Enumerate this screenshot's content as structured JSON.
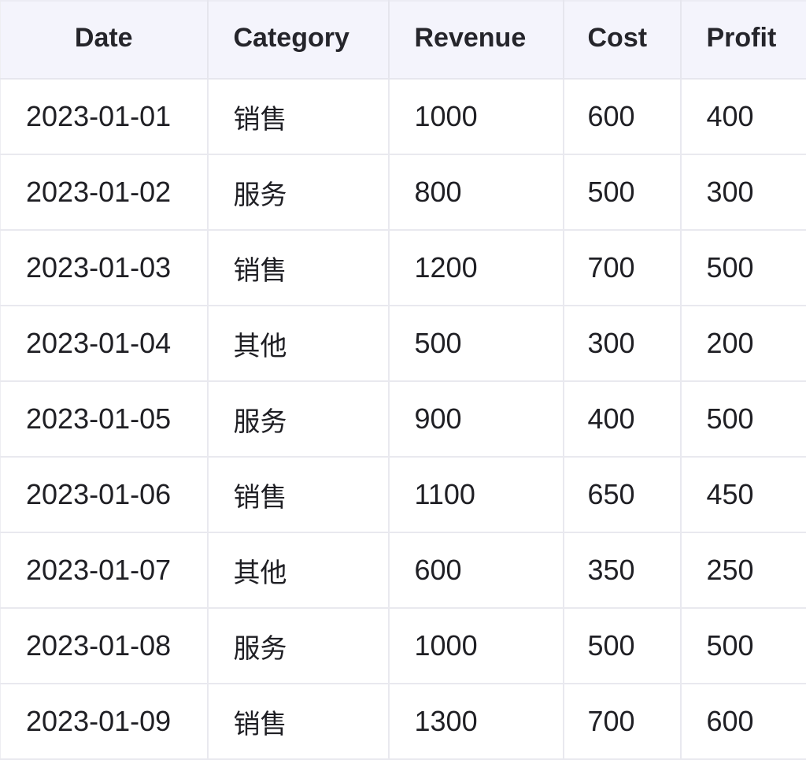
{
  "chart_data": {
    "type": "table",
    "columns": [
      "Date",
      "Category",
      "Revenue",
      "Cost",
      "Profit"
    ],
    "rows": [
      [
        "2023-01-01",
        "销售",
        "1000",
        "600",
        "400"
      ],
      [
        "2023-01-02",
        "服务",
        "800",
        "500",
        "300"
      ],
      [
        "2023-01-03",
        "销售",
        "1200",
        "700",
        "500"
      ],
      [
        "2023-01-04",
        "其他",
        "500",
        "300",
        "200"
      ],
      [
        "2023-01-05",
        "服务",
        "900",
        "400",
        "500"
      ],
      [
        "2023-01-06",
        "销售",
        "1100",
        "650",
        "450"
      ],
      [
        "2023-01-07",
        "其他",
        "600",
        "350",
        "250"
      ],
      [
        "2023-01-08",
        "服务",
        "1000",
        "500",
        "500"
      ],
      [
        "2023-01-09",
        "销售",
        "1300",
        "700",
        "600"
      ]
    ]
  },
  "colors": {
    "header_background": "#f4f4fc",
    "grid_line": "#e9e9ef",
    "text": "#1f1f24"
  }
}
